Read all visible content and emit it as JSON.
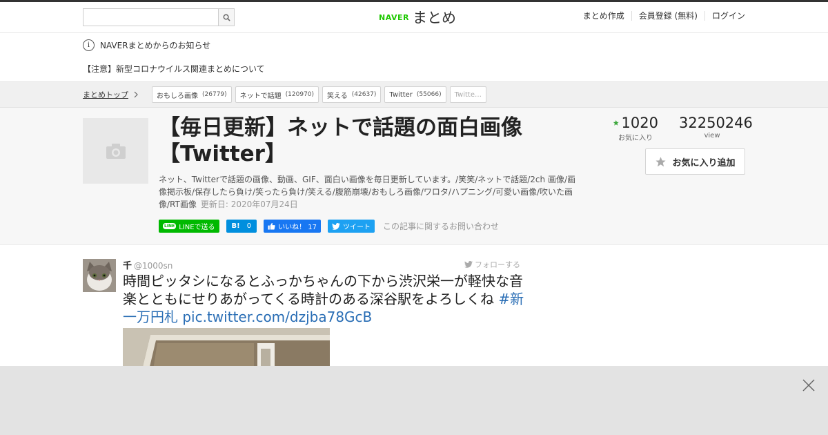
{
  "header": {
    "search_placeholder": "",
    "logo_naver": "NAVER",
    "logo_matome": "まとめ",
    "nav": [
      "まとめ作成",
      "会員登録 (無料)",
      "ログイン"
    ]
  },
  "notice": {
    "title": "NAVERまとめからのお知らせ",
    "link": "【注意】新型コロナウイルス関連まとめについて"
  },
  "breadcrumb": {
    "home": "まとめトップ",
    "tags": [
      {
        "label": "おもしろ画像",
        "count": "(26779)"
      },
      {
        "label": "ネットで話題",
        "count": "(120970)"
      },
      {
        "label": "笑える",
        "count": "(42637)"
      },
      {
        "label": "Twitter",
        "count": "(55066)"
      },
      {
        "label": "Twitte…",
        "count": ""
      }
    ]
  },
  "article": {
    "title": "【毎日更新】ネットで話題の面白画像【Twitter】",
    "description": "ネット、Twitterで話題の画像、動画、GIF、面白い画像を毎日更新しています。/笑笑/ネットで話題/2ch 画像/画像掲示板/保存したら負け/笑ったら負け/笑える/腹筋崩壊/おもしろ画像/ワロタ/ハプニング/可愛い画像/吹いた画像/RT画像",
    "updated": "更新日: 2020年07月24日",
    "favorites": "1020",
    "favorites_label": "お気に入り",
    "views": "32250246",
    "views_label": "view",
    "fav_button": "お気に入り追加",
    "share": {
      "line": "LINEで送る",
      "line_badge": "LINE",
      "hatena": "0",
      "hatena_label": "B!",
      "facebook": "いいね！ 17",
      "twitter": "ツイート"
    },
    "inquiry": "この記事に関するお問い合わせ"
  },
  "tweet": {
    "name": "千",
    "handle": "@1000sn",
    "follow": "フォローする",
    "text": "時間ピッタシになるとふっかちゃんの下から渋沢栄一が軽快な音楽とともにせりあがってくる時計のある深谷駅をよろしくね ",
    "hashtag": "#新一万円札",
    "link": "pic.twitter.com/dzjba78GcB"
  },
  "colors": {
    "line_green": "#00b900",
    "hatena_blue": "#008fde",
    "facebook_blue": "#1877f2",
    "twitter_blue": "#1da1f2",
    "fav_star": "#3ea83e",
    "naver_green": "#1ec800"
  },
  "icons": [
    "search-icon",
    "info-icon",
    "chevron-right-icon",
    "camera-icon",
    "star-icon",
    "thumbs-up-icon",
    "twitter-bird-icon",
    "close-icon"
  ]
}
